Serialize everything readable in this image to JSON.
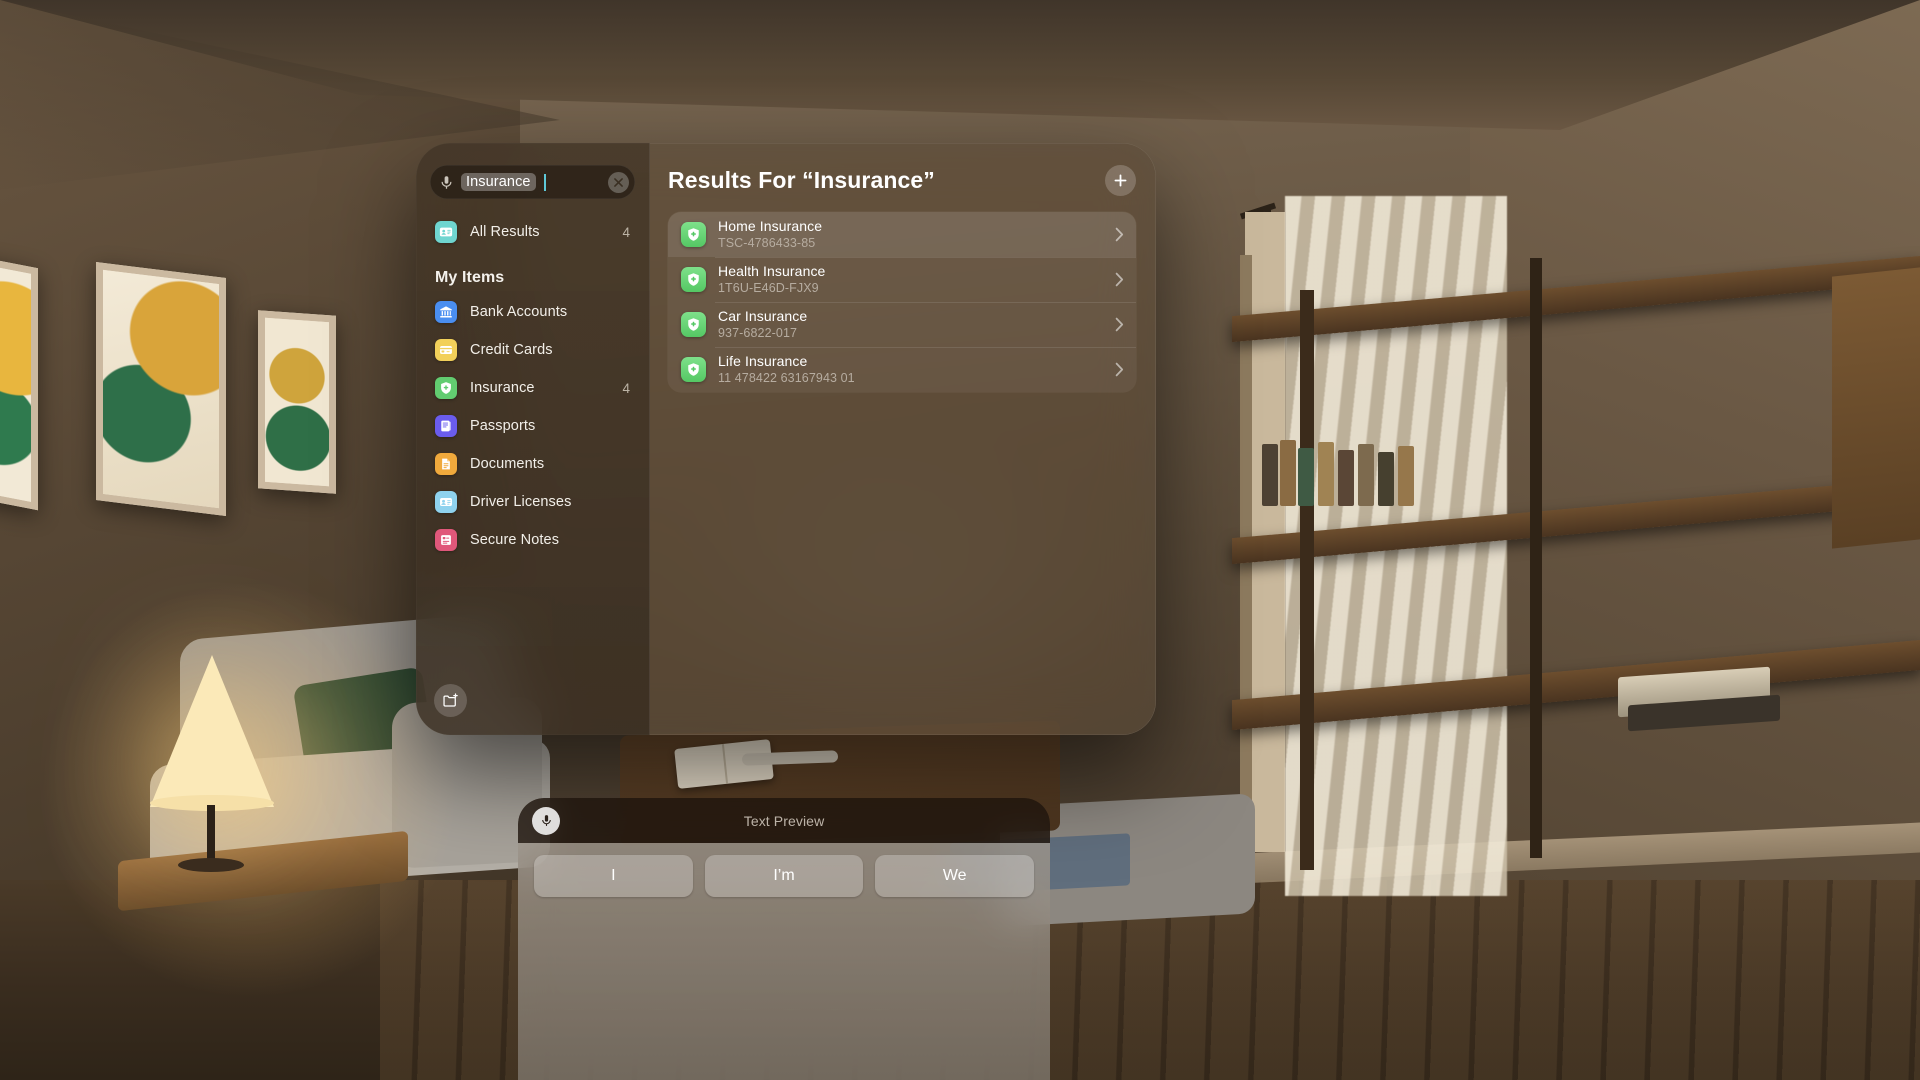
{
  "app": {
    "search": {
      "value": "Insurance",
      "mic_icon": "microphone-icon",
      "clear_icon": "clear-x-icon"
    },
    "sidebar": {
      "all_results": {
        "label": "All Results",
        "count": "4",
        "icon": "contact-card-icon",
        "color": "#6fd5d0"
      },
      "section_title": "My Items",
      "items": [
        {
          "label": "Bank Accounts",
          "count": "",
          "icon": "bank-icon",
          "color": "#4a8ef0"
        },
        {
          "label": "Credit Cards",
          "count": "",
          "icon": "credit-card-icon",
          "color": "#f2d05a"
        },
        {
          "label": "Insurance",
          "count": "4",
          "icon": "shield-plus-icon",
          "color": "#62cc70"
        },
        {
          "label": "Passports",
          "count": "",
          "icon": "passport-book-icon",
          "color": "#6a5ced"
        },
        {
          "label": "Documents",
          "count": "",
          "icon": "document-icon",
          "color": "#f0a93c"
        },
        {
          "label": "Driver Licenses",
          "count": "",
          "icon": "id-card-icon",
          "color": "#8fd2ee"
        },
        {
          "label": "Secure Notes",
          "count": "",
          "icon": "secure-note-icon",
          "color": "#e0577a"
        }
      ],
      "new_folder_icon": "new-folder-icon"
    },
    "results": {
      "title": "Results For “Insurance”",
      "add_icon": "plus-icon",
      "rows": [
        {
          "name": "Home Insurance",
          "subtitle": "TSC-4786433-85",
          "icon": "shield-plus-icon",
          "selected": true
        },
        {
          "name": "Health Insurance",
          "subtitle": "1T6U-E46D-FJX9",
          "icon": "shield-plus-icon",
          "selected": false
        },
        {
          "name": "Car Insurance",
          "subtitle": "937-6822-017",
          "icon": "shield-plus-icon",
          "selected": false
        },
        {
          "name": "Life Insurance",
          "subtitle": "11 478422 63167943 01",
          "icon": "shield-plus-icon",
          "selected": false
        }
      ]
    }
  },
  "keyboard": {
    "mic_icon": "microphone-icon",
    "preview_placeholder": "Text Preview",
    "suggestions": [
      "I",
      "I’m",
      "We"
    ]
  },
  "colors": {
    "accent_caret": "#5ec8d8",
    "insurance_green": "#62cc70",
    "panel_tint": "#564838"
  }
}
